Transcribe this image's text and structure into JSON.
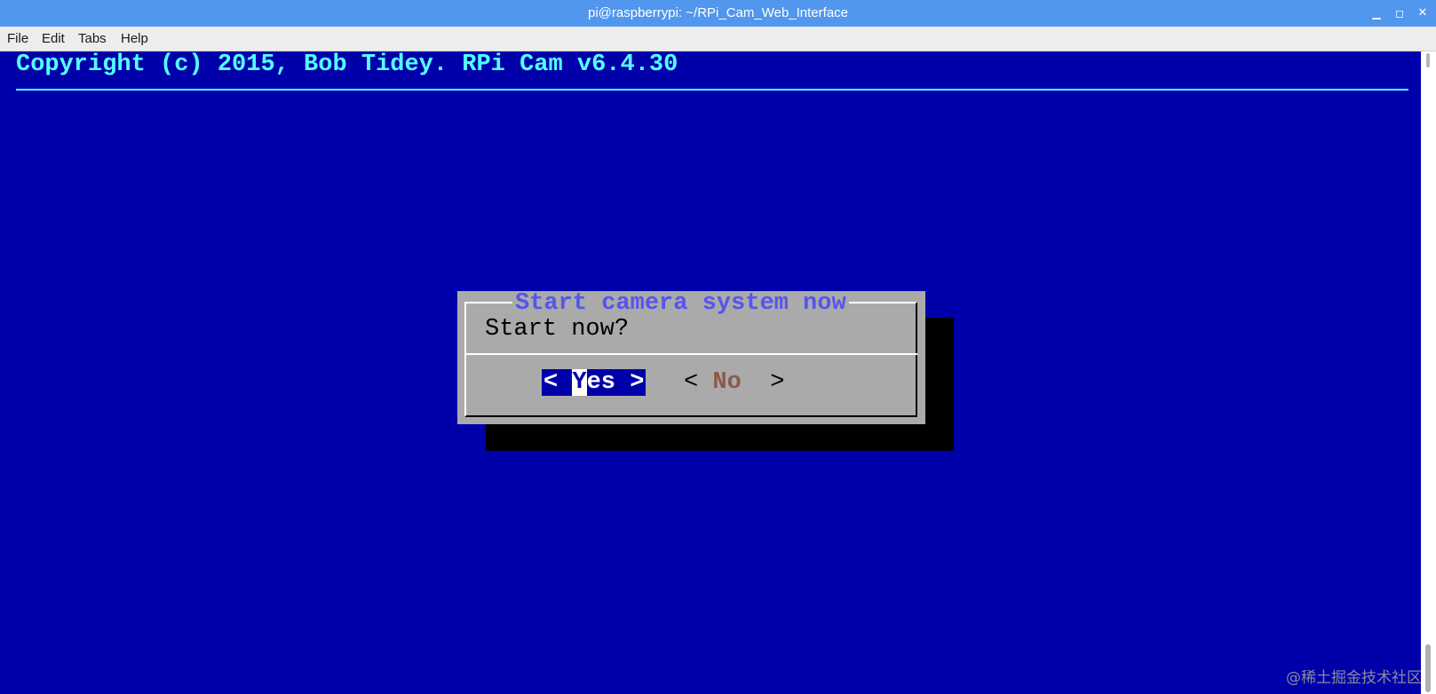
{
  "window": {
    "title": "pi@raspberrypi: ~/RPi_Cam_Web_Interface",
    "controls": {
      "minimize_icon": "minimize-icon",
      "maximize_icon": "maximize-icon",
      "close_icon": "close-icon"
    }
  },
  "menubar": {
    "items": [
      "File",
      "Edit",
      "Tabs",
      "Help"
    ]
  },
  "terminal": {
    "backtitle": "Copyright (c) 2015, Bob Tidey. RPi Cam v6.4.30",
    "colors": {
      "background": "#0000aa",
      "backtitle": "#55ffff",
      "dialog_background": "#aaaaaa",
      "dialog_title": "#5555ee",
      "selected_button": "#0000aa",
      "no_label": "#8a5a4a"
    }
  },
  "dialog": {
    "title": "Start camera system now",
    "prompt": "Start now?",
    "yes_button": {
      "left_bracket": "< ",
      "hotkey": "Y",
      "rest": "es",
      "right_bracket": " >",
      "selected": true
    },
    "no_button": {
      "left_bracket": "< ",
      "label": "No",
      "right_bracket": "  >",
      "selected": false
    }
  },
  "watermark": "@稀土掘金技术社区"
}
